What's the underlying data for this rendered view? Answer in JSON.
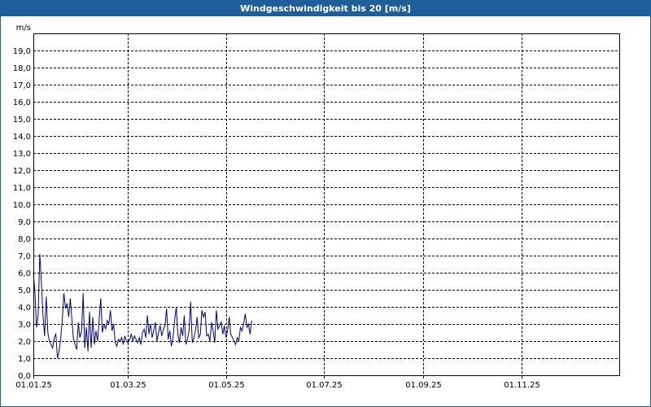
{
  "window": {
    "title": "Windgeschwindigkeit bis 20 [m/s]"
  },
  "colors": {
    "titlebar": "#1f5f99",
    "series": "#00008b",
    "grid": "#000000"
  },
  "chart_data": {
    "type": "line",
    "title": "Windgeschwindigkeit bis 20 [m/s]",
    "ylabel": "m/s",
    "xlabel": "",
    "ylim": [
      0,
      20
    ],
    "xlim": [
      "2025-01-01",
      "2025-12-31"
    ],
    "grid": true,
    "y_ticks": [
      "0,0",
      "1,0",
      "2,0",
      "3,0",
      "4,0",
      "5,0",
      "6,0",
      "7,0",
      "8,0",
      "9,0",
      "10,0",
      "11,0",
      "12,0",
      "13,0",
      "14,0",
      "15,0",
      "16,0",
      "17,0",
      "18,0",
      "19,0"
    ],
    "x_ticks": [
      {
        "date": "2025-01-01",
        "label": "01.01.25"
      },
      {
        "date": "2025-03-01",
        "label": "01.03.25"
      },
      {
        "date": "2025-05-01",
        "label": "01.05.25"
      },
      {
        "date": "2025-07-01",
        "label": "01.07.25"
      },
      {
        "date": "2025-09-01",
        "label": "01.09.25"
      },
      {
        "date": "2025-11-01",
        "label": "01.11.25"
      }
    ],
    "series": [
      {
        "values": [
          [
            "2025-01-01",
            6.0
          ],
          [
            "2025-01-02",
            4.8
          ],
          [
            "2025-01-03",
            2.8
          ],
          [
            "2025-01-04",
            3.5
          ],
          [
            "2025-01-05",
            7.1
          ],
          [
            "2025-01-06",
            5.4
          ],
          [
            "2025-01-07",
            3.5
          ],
          [
            "2025-01-08",
            2.3
          ],
          [
            "2025-01-09",
            4.6
          ],
          [
            "2025-01-10",
            2.5
          ],
          [
            "2025-01-11",
            2.0
          ],
          [
            "2025-01-12",
            1.8
          ],
          [
            "2025-01-13",
            1.6
          ],
          [
            "2025-01-14",
            2.2
          ],
          [
            "2025-01-15",
            2.4
          ],
          [
            "2025-01-16",
            1.0
          ],
          [
            "2025-01-17",
            1.4
          ],
          [
            "2025-01-18",
            2.1
          ],
          [
            "2025-01-19",
            3.2
          ],
          [
            "2025-01-20",
            4.8
          ],
          [
            "2025-01-21",
            3.9
          ],
          [
            "2025-01-22",
            4.2
          ],
          [
            "2025-01-23",
            3.4
          ],
          [
            "2025-01-24",
            4.5
          ],
          [
            "2025-01-25",
            3.3
          ],
          [
            "2025-01-26",
            2.1
          ],
          [
            "2025-01-27",
            1.8
          ],
          [
            "2025-01-28",
            1.5
          ],
          [
            "2025-01-29",
            3.1
          ],
          [
            "2025-01-30",
            2.2
          ],
          [
            "2025-01-31",
            2.6
          ],
          [
            "2025-02-01",
            4.8
          ],
          [
            "2025-02-02",
            1.6
          ],
          [
            "2025-02-03",
            2.8
          ],
          [
            "2025-02-04",
            1.4
          ],
          [
            "2025-02-05",
            3.7
          ],
          [
            "2025-02-06",
            1.6
          ],
          [
            "2025-02-07",
            3.4
          ],
          [
            "2025-02-08",
            1.8
          ],
          [
            "2025-02-09",
            2.6
          ],
          [
            "2025-02-10",
            2.0
          ],
          [
            "2025-02-11",
            3.3
          ],
          [
            "2025-02-12",
            4.5
          ],
          [
            "2025-02-13",
            2.5
          ],
          [
            "2025-02-14",
            3.0
          ],
          [
            "2025-02-15",
            2.7
          ],
          [
            "2025-02-16",
            3.2
          ],
          [
            "2025-02-17",
            3.0
          ],
          [
            "2025-02-18",
            3.8
          ],
          [
            "2025-02-19",
            2.6
          ],
          [
            "2025-02-20",
            3.0
          ],
          [
            "2025-02-21",
            1.9
          ],
          [
            "2025-02-22",
            1.7
          ],
          [
            "2025-02-23",
            2.1
          ],
          [
            "2025-02-24",
            2.0
          ],
          [
            "2025-02-25",
            2.2
          ],
          [
            "2025-02-26",
            1.8
          ],
          [
            "2025-02-27",
            2.3
          ],
          [
            "2025-02-28",
            2.0
          ],
          [
            "2025-03-01",
            1.9
          ],
          [
            "2025-03-02",
            2.1
          ],
          [
            "2025-03-03",
            2.4
          ],
          [
            "2025-03-04",
            2.0
          ],
          [
            "2025-03-05",
            2.3
          ],
          [
            "2025-03-06",
            2.1
          ],
          [
            "2025-03-07",
            1.9
          ],
          [
            "2025-03-08",
            2.2
          ],
          [
            "2025-03-09",
            1.8
          ],
          [
            "2025-03-10",
            2.5
          ],
          [
            "2025-03-11",
            2.7
          ],
          [
            "2025-03-12",
            2.2
          ],
          [
            "2025-03-13",
            3.5
          ],
          [
            "2025-03-14",
            2.4
          ],
          [
            "2025-03-15",
            3.0
          ],
          [
            "2025-03-16",
            2.2
          ],
          [
            "2025-03-17",
            2.6
          ],
          [
            "2025-03-18",
            3.1
          ],
          [
            "2025-03-19",
            2.0
          ],
          [
            "2025-03-20",
            2.5
          ],
          [
            "2025-03-21",
            2.9
          ],
          [
            "2025-03-22",
            2.3
          ],
          [
            "2025-03-23",
            2.7
          ],
          [
            "2025-03-24",
            2.9
          ],
          [
            "2025-03-25",
            3.9
          ],
          [
            "2025-03-26",
            2.1
          ],
          [
            "2025-03-27",
            2.6
          ],
          [
            "2025-03-28",
            1.7
          ],
          [
            "2025-03-29",
            2.2
          ],
          [
            "2025-03-30",
            3.2
          ],
          [
            "2025-03-31",
            4.0
          ],
          [
            "2025-04-01",
            2.4
          ],
          [
            "2025-04-02",
            1.9
          ],
          [
            "2025-04-03",
            2.8
          ],
          [
            "2025-04-04",
            2.3
          ],
          [
            "2025-04-05",
            3.5
          ],
          [
            "2025-04-06",
            1.8
          ],
          [
            "2025-04-07",
            2.1
          ],
          [
            "2025-04-08",
            2.6
          ],
          [
            "2025-04-09",
            4.3
          ],
          [
            "2025-04-10",
            1.9
          ],
          [
            "2025-04-11",
            2.2
          ],
          [
            "2025-04-12",
            2.6
          ],
          [
            "2025-04-13",
            3.4
          ],
          [
            "2025-04-14",
            2.2
          ],
          [
            "2025-04-15",
            2.4
          ],
          [
            "2025-04-16",
            3.8
          ],
          [
            "2025-04-17",
            3.4
          ],
          [
            "2025-04-18",
            3.7
          ],
          [
            "2025-04-19",
            2.3
          ],
          [
            "2025-04-20",
            2.4
          ],
          [
            "2025-04-21",
            2.0
          ],
          [
            "2025-04-22",
            3.1
          ],
          [
            "2025-04-23",
            2.6
          ],
          [
            "2025-04-24",
            1.9
          ],
          [
            "2025-04-25",
            3.8
          ],
          [
            "2025-04-26",
            2.7
          ],
          [
            "2025-04-27",
            2.9
          ],
          [
            "2025-04-28",
            3.1
          ],
          [
            "2025-04-29",
            2.4
          ],
          [
            "2025-04-30",
            2.9
          ],
          [
            "2025-05-01",
            2.2
          ],
          [
            "2025-05-02",
            2.6
          ],
          [
            "2025-05-03",
            3.4
          ],
          [
            "2025-05-04",
            2.4
          ],
          [
            "2025-05-05",
            2.2
          ],
          [
            "2025-05-06",
            2.0
          ],
          [
            "2025-05-07",
            1.8
          ],
          [
            "2025-05-08",
            2.2
          ],
          [
            "2025-05-09",
            2.0
          ],
          [
            "2025-05-10",
            2.8
          ],
          [
            "2025-05-11",
            2.6
          ],
          [
            "2025-05-12",
            3.0
          ],
          [
            "2025-05-13",
            3.6
          ],
          [
            "2025-05-14",
            2.8
          ],
          [
            "2025-05-15",
            3.0
          ],
          [
            "2025-05-16",
            2.4
          ],
          [
            "2025-05-17",
            3.2
          ]
        ]
      }
    ]
  }
}
